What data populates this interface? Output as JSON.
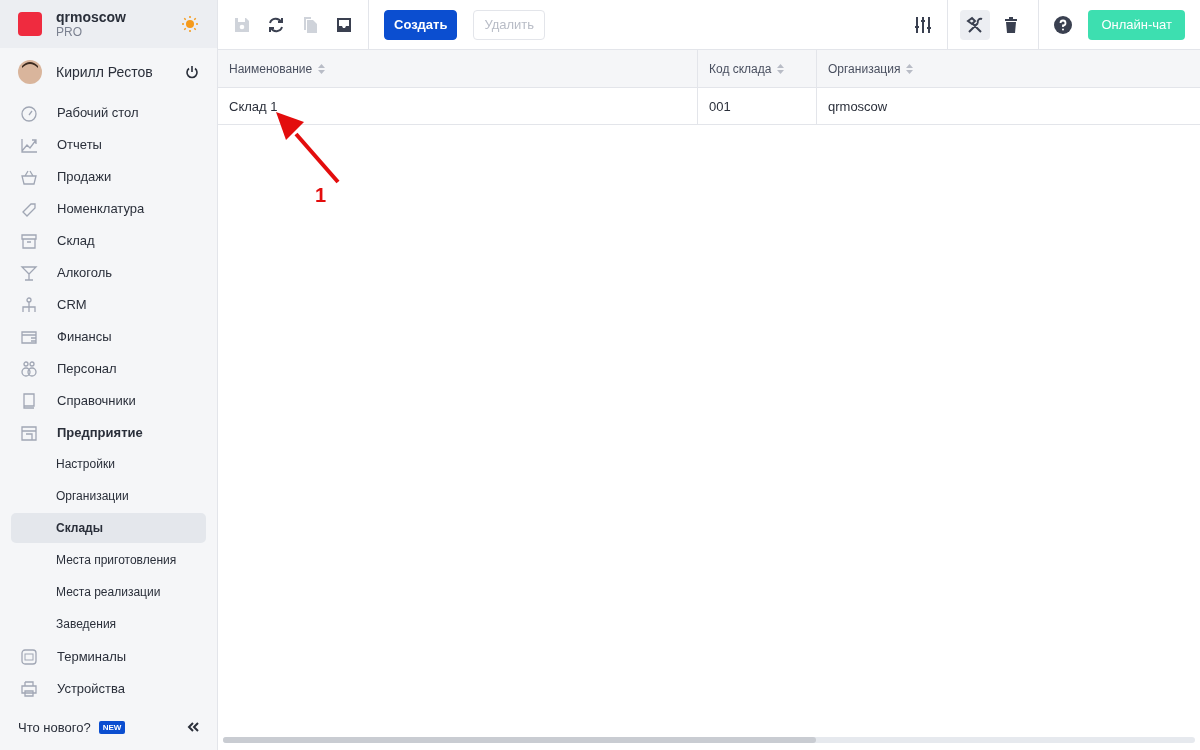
{
  "brand": {
    "name": "qrmoscow",
    "plan": "PRO"
  },
  "user": {
    "name": "Кирилл Рестов"
  },
  "sidebar": {
    "items": [
      {
        "label": "Рабочий стол",
        "selected": false,
        "expanded": false
      },
      {
        "label": "Отчеты",
        "selected": false,
        "expanded": false
      },
      {
        "label": "Продажи",
        "selected": false,
        "expanded": false
      },
      {
        "label": "Номенклатура",
        "selected": false,
        "expanded": false
      },
      {
        "label": "Склад",
        "selected": false,
        "expanded": false
      },
      {
        "label": "Алкоголь",
        "selected": false,
        "expanded": false
      },
      {
        "label": "CRM",
        "selected": false,
        "expanded": false
      },
      {
        "label": "Финансы",
        "selected": false,
        "expanded": false
      },
      {
        "label": "Персонал",
        "selected": false,
        "expanded": false
      },
      {
        "label": "Справочники",
        "selected": false,
        "expanded": false
      },
      {
        "label": "Предприятие",
        "selected": false,
        "expanded": true,
        "children": [
          {
            "label": "Настройки",
            "selected": false
          },
          {
            "label": "Организации",
            "selected": false
          },
          {
            "label": "Склады",
            "selected": true
          },
          {
            "label": "Места приготовления",
            "selected": false
          },
          {
            "label": "Места реализации",
            "selected": false
          },
          {
            "label": "Заведения",
            "selected": false
          }
        ]
      },
      {
        "label": "Терминалы",
        "selected": false,
        "expanded": false
      },
      {
        "label": "Устройства",
        "selected": false,
        "expanded": false
      }
    ]
  },
  "whats_new": {
    "label": "Что нового?",
    "badge": "NEW"
  },
  "toolbar": {
    "icons": [
      {
        "disabled": true
      },
      {
        "disabled": false
      },
      {
        "disabled": true
      },
      {
        "disabled": false
      }
    ],
    "buttons": [
      {
        "label": "Создать",
        "disabled": false
      },
      {
        "label": "Удалить",
        "disabled": true
      }
    ],
    "tools_selected": true,
    "chat": "Онлайн-чат"
  },
  "table": {
    "columns": [
      "Наименование",
      "Код склада",
      "Организация"
    ],
    "rows": [
      [
        "Склад 1",
        "001",
        "qrmoscow"
      ]
    ]
  },
  "annotation": {
    "label": "1"
  }
}
